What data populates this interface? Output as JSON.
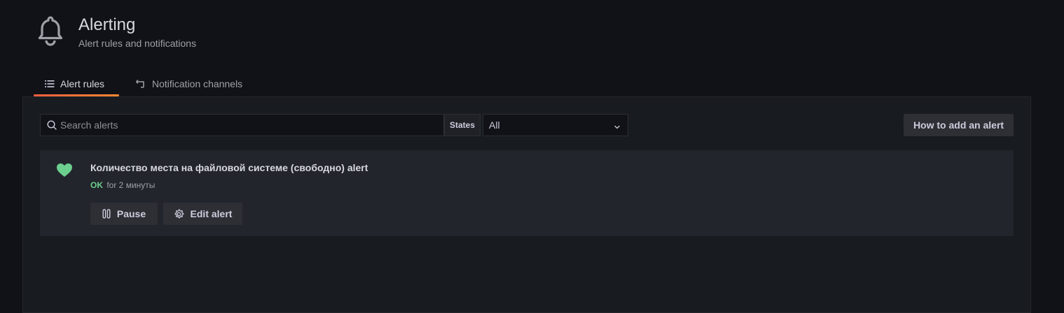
{
  "header": {
    "icon": "bell-icon",
    "title": "Alerting",
    "subtitle": "Alert rules and notifications"
  },
  "tabs": [
    {
      "label": "Alert rules",
      "icon": "list-icon",
      "active": true
    },
    {
      "label": "Notification channels",
      "icon": "channels-icon",
      "active": false
    }
  ],
  "toolbar": {
    "search_placeholder": "Search alerts",
    "search_value": "",
    "states_label": "States",
    "states_value": "All",
    "how_to_label": "How to add an alert"
  },
  "alerts": [
    {
      "name": "Количество места на файловой системе (свободно) alert",
      "state": "OK",
      "state_color": "#6ccf8e",
      "duration": "for 2 минуты",
      "icon": "heart-icon",
      "pause_label": "Pause",
      "edit_label": "Edit alert"
    }
  ],
  "colors": {
    "background": "#111217",
    "panel": "#181b1f",
    "card": "#22252b",
    "accent_gradient_start": "#f55f3e",
    "accent_gradient_end": "#ff8833"
  }
}
